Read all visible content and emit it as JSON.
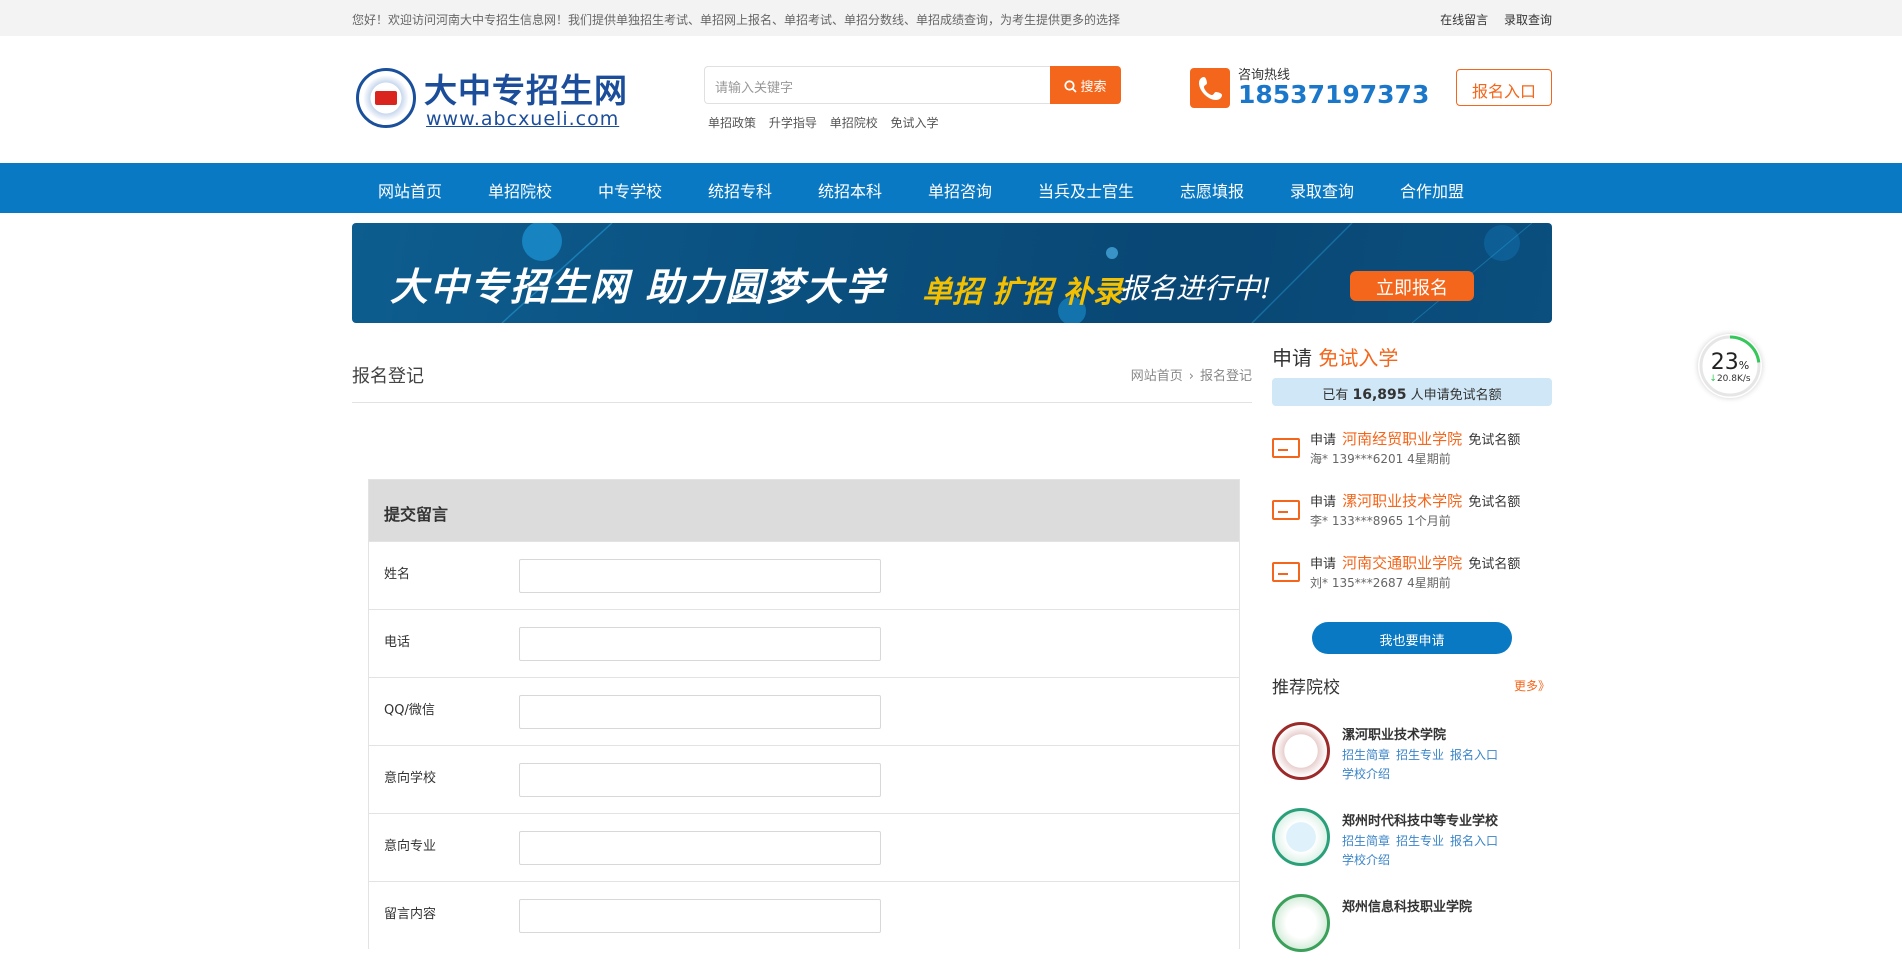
{
  "topbar": {
    "welcome": "您好！欢迎访问河南大中专招生信息网！我们提供单独招生考试、单招网上报名、单招考试、单招分数线、单招成绩查询，为考生提供更多的选择",
    "links": [
      "在线留言",
      "录取查询"
    ]
  },
  "logo": {
    "cn": "大中专招生网",
    "en": "www.abcxueli.com"
  },
  "search": {
    "placeholder": "请输入关键字",
    "button": "搜索",
    "hot": [
      "单招政策",
      "升学指导",
      "单招院校",
      "免试入学"
    ]
  },
  "hotline": {
    "label": "咨询热线",
    "number": "18537197373"
  },
  "register_button": "报名入口",
  "nav": [
    "网站首页",
    "单招院校",
    "中专学校",
    "统招专科",
    "统招本科",
    "单招咨询",
    "当兵及士官生",
    "志愿填报",
    "录取查询",
    "合作加盟"
  ],
  "banner": {
    "t1": "大中专招生网 助力圆梦大学",
    "t2": "单招 扩招 补录",
    "t3": "报名进行中!",
    "cta": "立即报名"
  },
  "main": {
    "title": "报名登记",
    "breadcrumb": [
      "网站首页",
      "报名登记"
    ],
    "form": {
      "title": "提交留言",
      "fields": [
        "姓名",
        "电话",
        "QQ/微信",
        "意向学校",
        "意向专业",
        "留言内容"
      ]
    }
  },
  "side": {
    "heading_a": "申请",
    "heading_b": "免试入学",
    "count_prefix": "已有",
    "count_value": "16,895",
    "count_suffix": "人申请免试名额",
    "applications": [
      {
        "pre": "申请",
        "school": "河南经贸职业学院",
        "post": "免试名额",
        "meta": "海* 139***6201 4星期前"
      },
      {
        "pre": "申请",
        "school": "漯河职业技术学院",
        "post": "免试名额",
        "meta": "李* 133***8965 1个月前"
      },
      {
        "pre": "申请",
        "school": "河南交通职业学院",
        "post": "免试名额",
        "meta": "刘* 135***2687 4星期前"
      }
    ],
    "apply_button": "我也要申请",
    "recommend_title": "推荐院校",
    "more": "更多》",
    "schools": [
      {
        "name": "漯河职业技术学院",
        "links": [
          "招生简章",
          "招生专业",
          "报名入口",
          "学校介绍"
        ]
      },
      {
        "name": "郑州时代科技中等专业学校",
        "links": [
          "招生简章",
          "招生专业",
          "报名入口",
          "学校介绍"
        ]
      },
      {
        "name": "郑州信息科技职业学院",
        "links": []
      }
    ]
  },
  "speed_widget": {
    "percent": "23",
    "unit": "%",
    "rate": "20.8K/s"
  },
  "colors": {
    "brand_blue": "#0a79c3",
    "accent_orange": "#f4661b"
  }
}
